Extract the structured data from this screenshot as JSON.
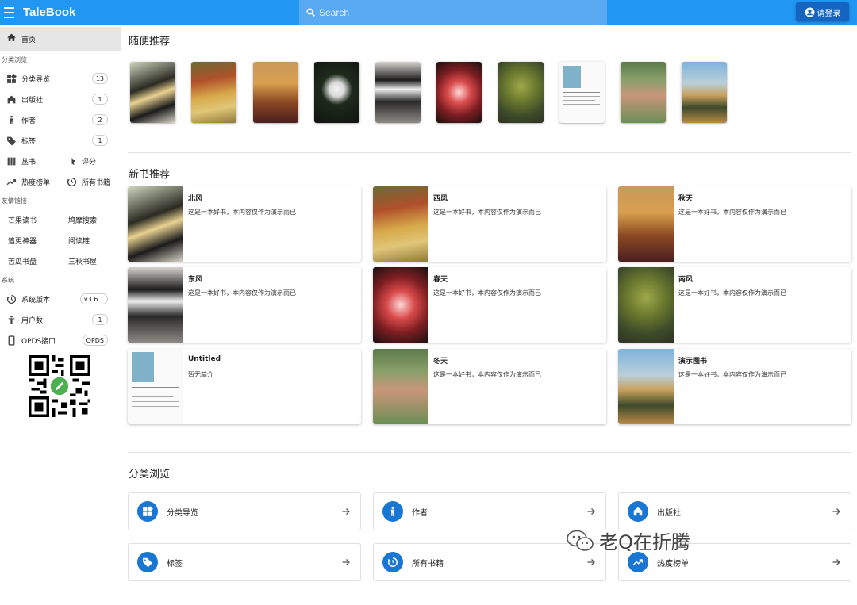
{
  "app": {
    "title": "TaleBook"
  },
  "search": {
    "placeholder": "Search"
  },
  "header": {
    "login_label": "请登录"
  },
  "sidebar": {
    "home": "首页",
    "browse_label": "分类浏览",
    "browse_items": [
      {
        "label": "分类导览",
        "count": "13",
        "icon": "category-icon"
      },
      {
        "label": "出版社",
        "count": "1",
        "icon": "publisher-icon"
      },
      {
        "label": "作者",
        "count": "2",
        "icon": "author-icon"
      },
      {
        "label": "标签",
        "count": "1",
        "icon": "tag-icon"
      }
    ],
    "series": "丛书",
    "rating": "评分",
    "hot": "热度榜单",
    "all_books": "所有书籍",
    "links_label": "友情链接",
    "links": [
      "芒果读书",
      "鸠摩搜索",
      "追更神器",
      "阅读链",
      "苦瓜书盘",
      "三秋书屋"
    ],
    "system_label": "系统",
    "system_items": [
      {
        "label": "系统版本",
        "value": "v3.6.1"
      },
      {
        "label": "用户数",
        "value": "1"
      },
      {
        "label": "OPDS接口",
        "value": "OPDS"
      }
    ]
  },
  "main": {
    "random_title": "随便推荐",
    "new_title": "新书推荐",
    "browse_title": "分类浏览",
    "books": [
      {
        "title": "北风",
        "desc": "这是一本好书，本内容仅作为演示而已"
      },
      {
        "title": "西风",
        "desc": "这是一本好书，本内容仅作为演示而已"
      },
      {
        "title": "秋天",
        "desc": "这是一本好书，本内容仅作为演示而已"
      },
      {
        "title": "东风",
        "desc": "这是一本好书，本内容仅作为演示而已"
      },
      {
        "title": "春天",
        "desc": "这是一本好书，本内容仅作为演示而已"
      },
      {
        "title": "南风",
        "desc": "这是一本好书，本内容仅作为演示而已"
      },
      {
        "title": "Untitled",
        "desc": "暂无简介"
      },
      {
        "title": "冬天",
        "desc": "这是一本好书，本内容仅作为演示而已"
      },
      {
        "title": "演示图书",
        "desc": "这是一本好书，本内容仅作为演示而已"
      }
    ],
    "categories": [
      {
        "label": "分类导览",
        "icon": "category-icon"
      },
      {
        "label": "作者",
        "icon": "author-icon"
      },
      {
        "label": "出版社",
        "icon": "publisher-icon"
      },
      {
        "label": "标签",
        "icon": "tag-icon"
      },
      {
        "label": "所有书籍",
        "icon": "history-icon"
      },
      {
        "label": "热度榜单",
        "icon": "trending-icon"
      }
    ]
  },
  "watermark": {
    "text": "老Q在折腾"
  },
  "colors": {
    "primary": "#2196f3",
    "accent": "#1976d2",
    "login": "#1565c0"
  }
}
